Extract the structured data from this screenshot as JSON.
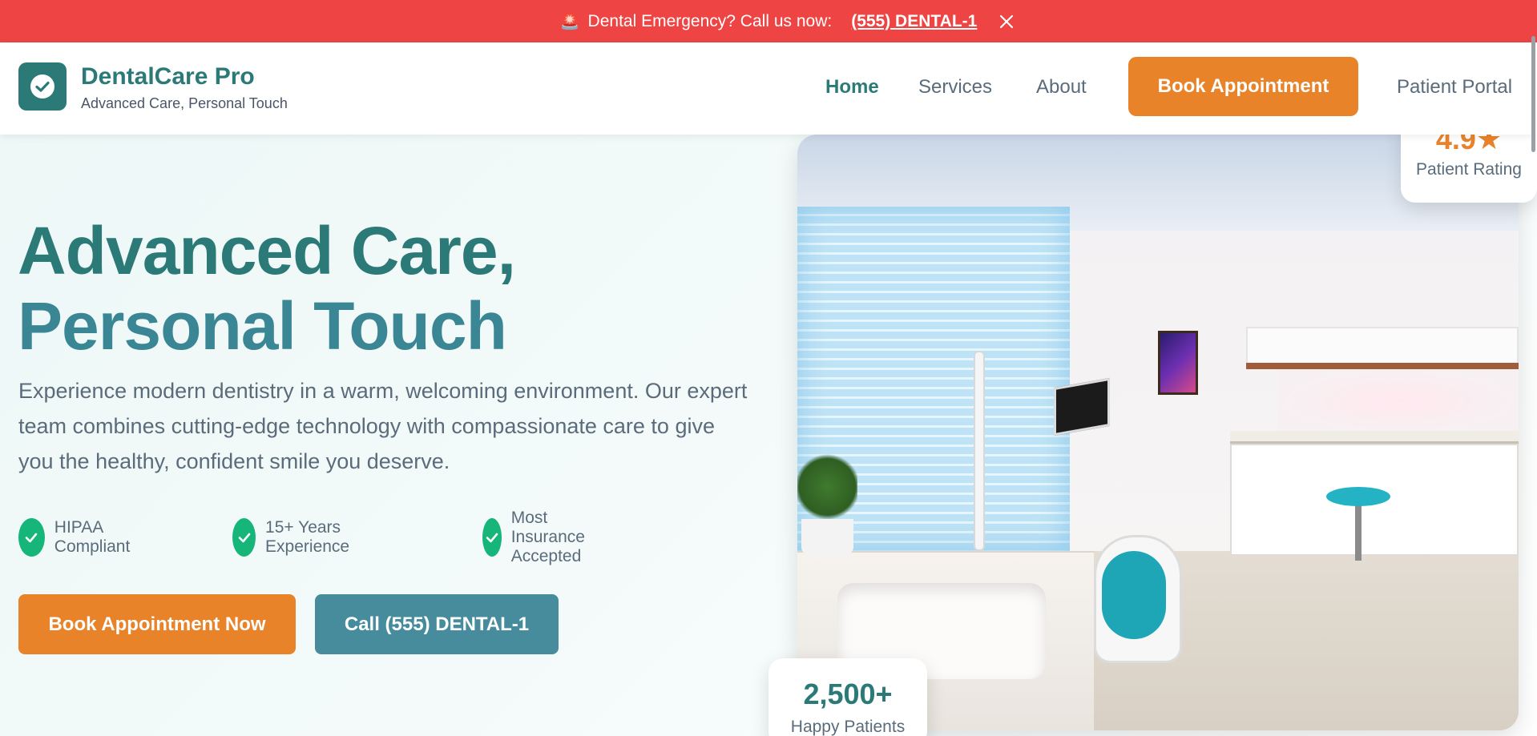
{
  "emergency": {
    "icon": "siren-icon",
    "text": "Dental Emergency? Call us now:",
    "phone": "(555) DENTAL-1",
    "bg_color": "#ef4444"
  },
  "header": {
    "brand_name": "DentalCare Pro",
    "tagline": "Advanced Care, Personal Touch",
    "logo_icon": "check-icon",
    "nav": {
      "home": "Home",
      "services": "Services",
      "about": "About",
      "book": "Book Appointment",
      "portal": "Patient Portal"
    },
    "active_nav": "Home"
  },
  "hero": {
    "title_line1": "Advanced Care,",
    "title_line2": "Personal Touch",
    "description": "Experience modern dentistry in a warm, welcoming environment. Our expert team combines cutting-edge technology with compassionate care to give you the healthy, confident smile you deserve.",
    "features": [
      "HIPAA Compliant",
      "15+ Years Experience",
      "Most Insurance Accepted"
    ],
    "primary_button": "Book Appointment Now",
    "secondary_button": "Call (555) DENTAL-1"
  },
  "stats": {
    "rating_value": "4.9★",
    "rating_label": "Patient Rating",
    "patients_value": "2,500+",
    "patients_label": "Happy Patients"
  },
  "colors": {
    "brand": "#2b7a78",
    "accent": "#e8832a",
    "secondary": "#468c9c",
    "success": "#16b67a"
  }
}
